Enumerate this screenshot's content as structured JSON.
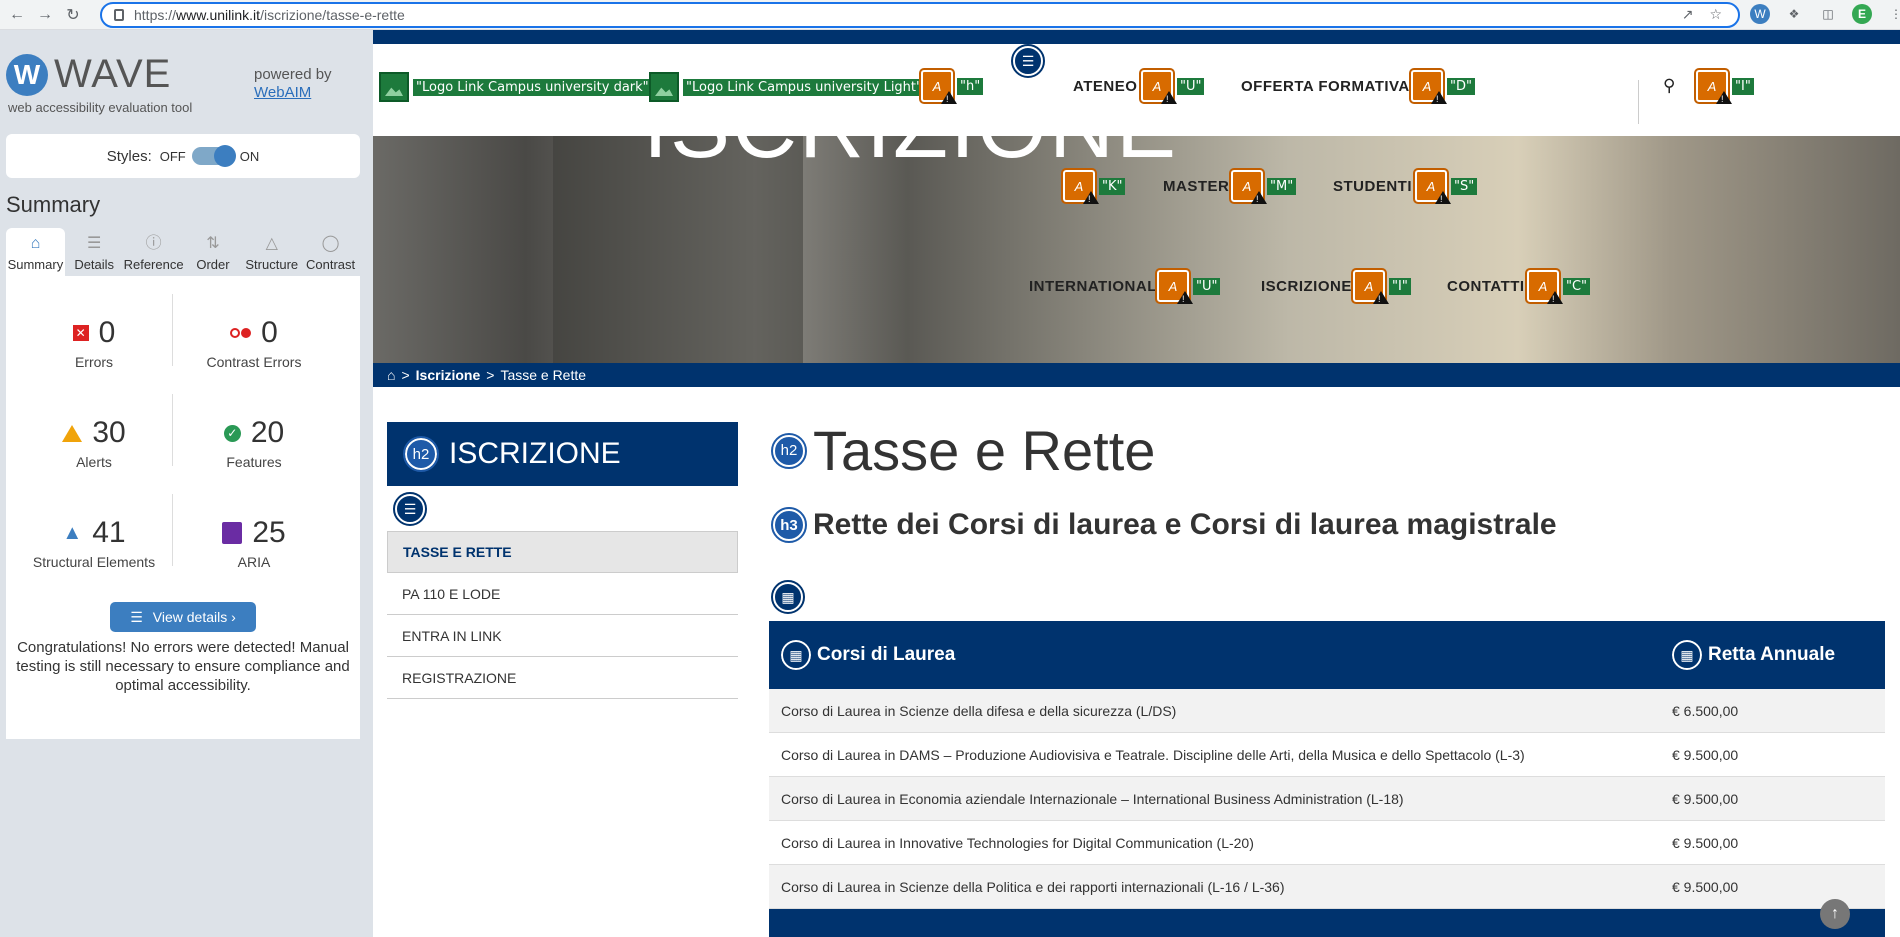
{
  "browser": {
    "url_proto": "https://",
    "url_host": "www.unilink.it",
    "url_path": "/iscrizione/tasse-e-rette",
    "avatar_letter": "E"
  },
  "wave": {
    "logo_letter": "W",
    "name": "WAVE",
    "subtitle": "web accessibility evaluation tool",
    "powered_by": "powered by",
    "webaim": "WebAIM",
    "styles_label": "Styles:",
    "styles_off": "OFF",
    "styles_on": "ON",
    "summary_title": "Summary",
    "tabs": [
      {
        "label": "Summary",
        "icon": "home-icon"
      },
      {
        "label": "Details",
        "icon": "list-icon"
      },
      {
        "label": "Reference",
        "icon": "info-icon"
      },
      {
        "label": "Order",
        "icon": "order-icon"
      },
      {
        "label": "Structure",
        "icon": "structure-icon"
      },
      {
        "label": "Contrast",
        "icon": "contrast-icon"
      }
    ],
    "stats": {
      "errors": {
        "value": "0",
        "label": "Errors"
      },
      "contrast_errors": {
        "value": "0",
        "label": "Contrast Errors"
      },
      "alerts": {
        "value": "30",
        "label": "Alerts"
      },
      "features": {
        "value": "20",
        "label": "Features"
      },
      "structural": {
        "value": "41",
        "label": "Structural Elements"
      },
      "aria": {
        "value": "25",
        "label": "ARIA"
      }
    },
    "view_details": "View details ›",
    "congrats": "Congratulations! No errors were detected! Manual testing is still necessary to ensure compliance and optimal accessibility."
  },
  "site": {
    "hero_text": "ISCRIZIONE",
    "logo_dark_tag": "\"Logo Link Campus university dark\"",
    "logo_light_tag": "\"Logo Link Campus university Light\"",
    "h_tag": "\"h\"",
    "nav": [
      {
        "label": "ATENEO",
        "tag": "\"U\""
      },
      {
        "label": "OFFERTA FORMATIVA",
        "tag": "\"D\""
      },
      {
        "label": "",
        "tag": "\"K\""
      },
      {
        "label": "MASTER",
        "tag": "\"M\""
      },
      {
        "label": "STUDENTI",
        "tag": "\"S\""
      },
      {
        "label": "INTERNATIONAL",
        "tag": "\"U\""
      },
      {
        "label": "ISCRIZIONE",
        "tag": "\"I\""
      },
      {
        "label": "CONTATTI",
        "tag": "\"C\""
      }
    ],
    "search_tag": "\"I\"",
    "alert_letter": "A",
    "breadcrumb": {
      "sep1": ">",
      "item1": "Iscrizione",
      "sep2": ">",
      "item2": "Tasse e Rette"
    },
    "sidebar": {
      "heading_badge": "h2",
      "heading": "ISCRIZIONE",
      "items": [
        "TASSE E RETTE",
        "PA 110 E LODE",
        "ENTRA IN LINK",
        "REGISTRAZIONE"
      ]
    },
    "page_title_badge": "h2",
    "page_title": "Tasse e Rette",
    "subtitle_badge": "h3",
    "subtitle": "Rette dei Corsi di laurea e Corsi di laurea magistrale",
    "table": {
      "headers": [
        "Corsi di Laurea",
        "Retta Annuale"
      ],
      "rows": [
        [
          "Corso di Laurea in Scienze della difesa e della sicurezza (L/DS)",
          "€ 6.500,00"
        ],
        [
          "Corso di Laurea in DAMS – Produzione Audiovisiva e Teatrale. Discipline delle Arti, della Musica e dello Spettacolo (L-3)",
          "€ 9.500,00"
        ],
        [
          "Corso di Laurea in Economia aziendale Internazionale – International Business Administration (L-18)",
          "€ 9.500,00"
        ],
        [
          "Corso di Laurea in Innovative Technologies for Digital Communication (L-20)",
          "€ 9.500,00"
        ],
        [
          "Corso di Laurea in Scienze della Politica e dei rapporti internazionali (L-16 / L-36)",
          "€ 9.500,00"
        ]
      ]
    }
  }
}
